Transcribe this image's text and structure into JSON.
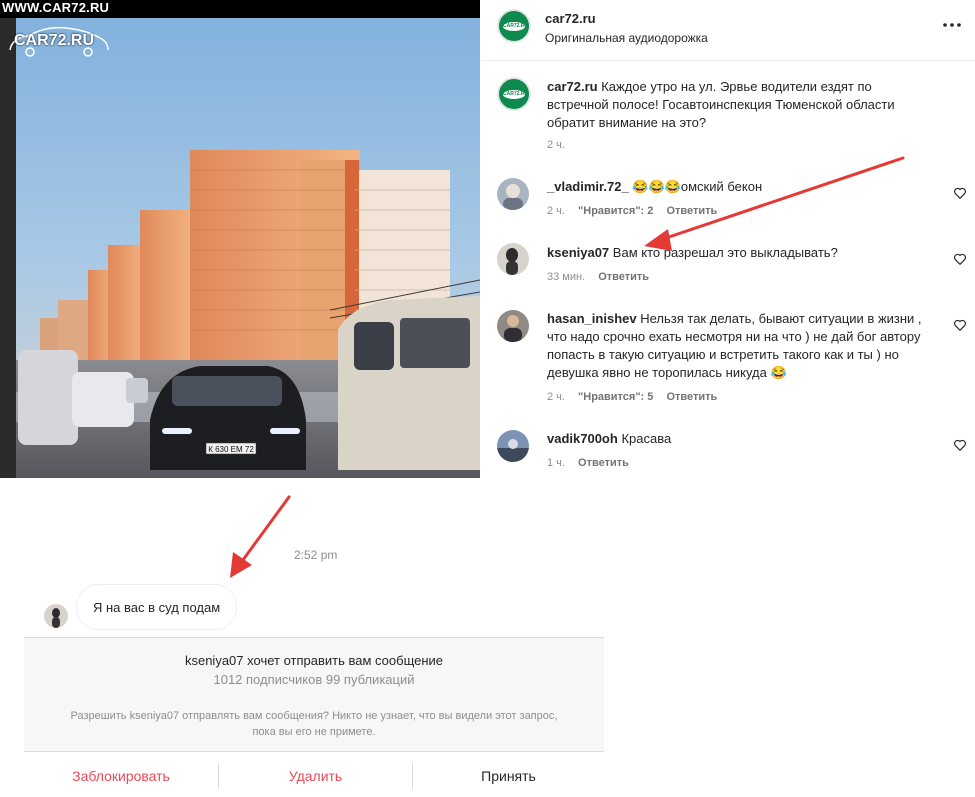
{
  "watermark": {
    "top_text": "WWW.CAR72.RU",
    "logo_text": "CAR72.RU",
    "plate_text": "К 630 ЕМ 72"
  },
  "post": {
    "author": "car72.ru",
    "audio": "Оригинальная аудиодорожка",
    "more_icon": "more-dots-icon",
    "avatar_label": "CAR72.RU",
    "caption": {
      "username": "car72.ru",
      "text": "Каждое утро на ул. Эрвье водители ездят по встречной полосе! Госавтоинспекция Тюменской области обратит внимание на это?",
      "time": "2 ч."
    }
  },
  "comments": [
    {
      "username": "_vladimir.72_",
      "emoji": "😂😂😂",
      "text": "омский бекон",
      "time": "2 ч.",
      "likes": "\"Нравится\": 2",
      "reply": "Ответить"
    },
    {
      "username": "kseniya07",
      "text": "Вам кто разрешал это выкладывать?",
      "time": "33 мин.",
      "likes": "",
      "reply": "Ответить"
    },
    {
      "username": "hasan_inishev",
      "text": "Нельзя так делать, бывают ситуации в жизни , что надо срочно ехать несмотря ни на что ) не дай бог автору попасть в такую ситуацию и встретить такого как и ты ) но девушка явно не торопилась никуда 😂",
      "time": "2 ч.",
      "likes": "\"Нравится\": 5",
      "reply": "Ответить"
    },
    {
      "username": "vadik700oh",
      "text": "Красава",
      "time": "1 ч.",
      "likes": "",
      "reply": "Ответить"
    }
  ],
  "dm": {
    "timestamp": "2:52 pm",
    "message": "Я на вас в суд подам",
    "request_user": "kseniya07",
    "request_title_suffix": "хочет отправить вам сообщение",
    "request_stats": "1012 подписчиков 99 публикаций",
    "request_note_1": "Разрешить kseniya07 отправлять вам сообщения? Никто не узнает, что вы видели этот запрос,",
    "request_note_2": "пока вы его не примете.",
    "actions": {
      "block": "Заблокировать",
      "delete": "Удалить",
      "accept": "Принять"
    }
  },
  "colors": {
    "danger": "#ed4956",
    "annotation_arrow": "#e53935",
    "brand_green": "#0e8a4f",
    "meta_gray": "#8e8e8e"
  }
}
